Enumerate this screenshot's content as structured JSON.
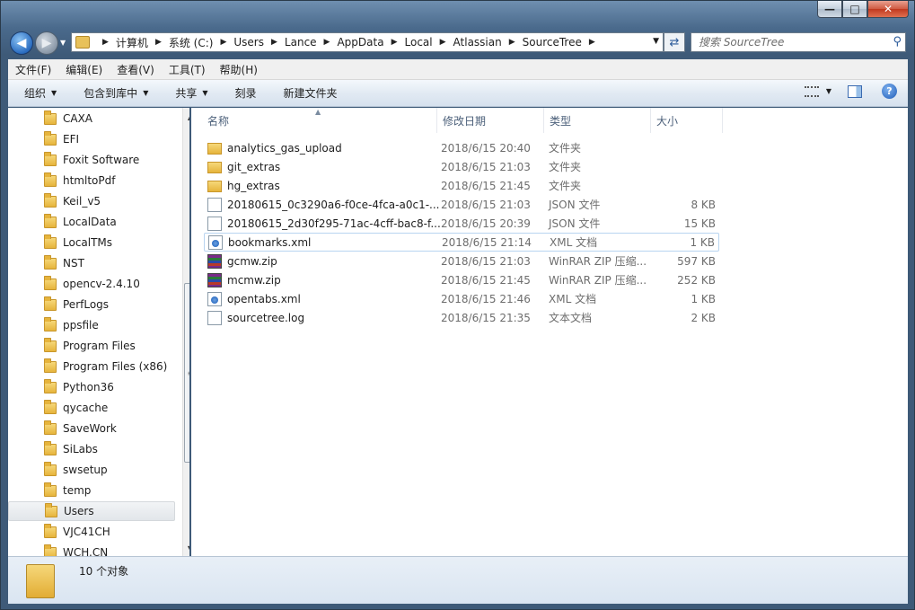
{
  "window": {
    "min_label": "—",
    "max_label": "□",
    "close_label": "✕"
  },
  "address": {
    "crumbs": [
      "计算机",
      "系统 (C:)",
      "Users",
      "Lance",
      "AppData",
      "Local",
      "Atlassian",
      "SourceTree"
    ],
    "search_placeholder": "搜索 SourceTree"
  },
  "menubar": {
    "items": [
      "文件(F)",
      "编辑(E)",
      "查看(V)",
      "工具(T)",
      "帮助(H)"
    ]
  },
  "toolbar": {
    "organize": "组织",
    "include_library": "包含到库中",
    "share": "共享",
    "burn": "刻录",
    "new_folder": "新建文件夹"
  },
  "navpane": {
    "items": [
      "CAXA",
      "EFI",
      "Foxit Software",
      "htmltoPdf",
      "Keil_v5",
      "LocalData",
      "LocalTMs",
      "NST",
      "opencv-2.4.10",
      "PerfLogs",
      "ppsfile",
      "Program Files",
      "Program Files (x86)",
      "Python36",
      "qycache",
      "SaveWork",
      "SiLabs",
      "swsetup",
      "temp",
      "Users",
      "VJC41CH",
      "WCH.CN"
    ],
    "selected": "Users"
  },
  "columns": {
    "name": "名称",
    "date": "修改日期",
    "type": "类型",
    "size": "大小"
  },
  "files": [
    {
      "name": "analytics_gas_upload",
      "date": "2018/6/15 20:40",
      "type": "文件夹",
      "size": "",
      "icon": "folder"
    },
    {
      "name": "git_extras",
      "date": "2018/6/15 21:03",
      "type": "文件夹",
      "size": "",
      "icon": "folder"
    },
    {
      "name": "hg_extras",
      "date": "2018/6/15 21:45",
      "type": "文件夹",
      "size": "",
      "icon": "folder"
    },
    {
      "name": "20180615_0c3290a6-f0ce-4fca-a0c1-...",
      "date": "2018/6/15 21:03",
      "type": "JSON 文件",
      "size": "8 KB",
      "icon": "file"
    },
    {
      "name": "20180615_2d30f295-71ac-4cff-bac8-f...",
      "date": "2018/6/15 20:39",
      "type": "JSON 文件",
      "size": "15 KB",
      "icon": "file"
    },
    {
      "name": "bookmarks.xml",
      "date": "2018/6/15 21:14",
      "type": "XML 文档",
      "size": "1 KB",
      "icon": "xml"
    },
    {
      "name": "gcmw.zip",
      "date": "2018/6/15 21:03",
      "type": "WinRAR ZIP 压缩...",
      "size": "597 KB",
      "icon": "zip"
    },
    {
      "name": "mcmw.zip",
      "date": "2018/6/15 21:45",
      "type": "WinRAR ZIP 压缩...",
      "size": "252 KB",
      "icon": "zip"
    },
    {
      "name": "opentabs.xml",
      "date": "2018/6/15 21:46",
      "type": "XML 文档",
      "size": "1 KB",
      "icon": "xml"
    },
    {
      "name": "sourcetree.log",
      "date": "2018/6/15 21:35",
      "type": "文本文档",
      "size": "2 KB",
      "icon": "file"
    }
  ],
  "status": {
    "count_text": "10 个对象"
  }
}
